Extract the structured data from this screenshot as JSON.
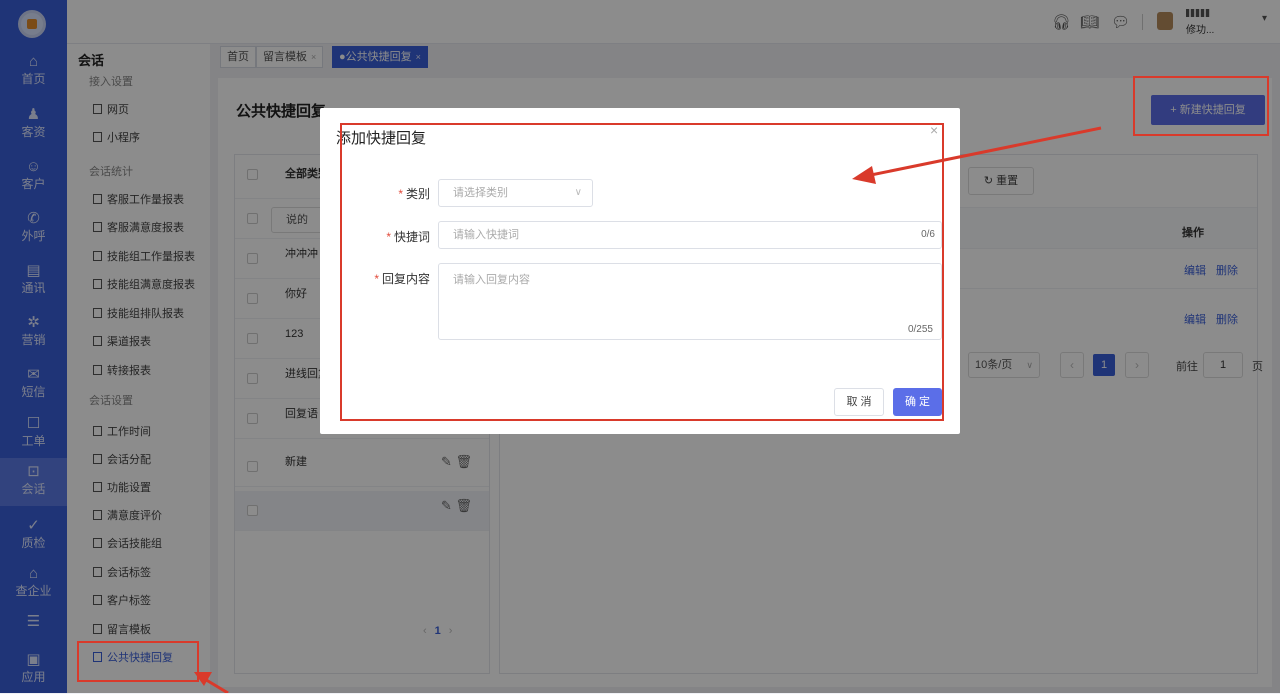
{
  "nav": {
    "items": [
      {
        "icon": "home-icon",
        "glyph": "⌂",
        "label": "首页"
      },
      {
        "icon": "visitors-icon",
        "glyph": "♟",
        "label": "客资"
      },
      {
        "icon": "customer-icon",
        "glyph": "☺",
        "label": "客户"
      },
      {
        "icon": "phone-icon",
        "glyph": "✆",
        "label": "外呼"
      },
      {
        "icon": "contacts-icon",
        "glyph": "▤",
        "label": "通讯"
      },
      {
        "icon": "marketing-icon",
        "glyph": "✲",
        "label": "营销"
      },
      {
        "icon": "sms-icon",
        "glyph": "✉",
        "label": "短信"
      },
      {
        "icon": "ticket-icon",
        "glyph": "☐",
        "label": "工单"
      },
      {
        "icon": "chat-icon",
        "glyph": "⊡",
        "label": "会话"
      },
      {
        "icon": "quality-icon",
        "glyph": "✓",
        "label": "质检"
      },
      {
        "icon": "enterprise-icon",
        "glyph": "⌂",
        "label": "查企业"
      },
      {
        "icon": "list-icon",
        "glyph": "☰",
        "label": ""
      },
      {
        "icon": "apps-icon",
        "glyph": "▣",
        "label": "应用"
      }
    ]
  },
  "topbar": {
    "icons": [
      "headset-icon",
      "book-icon",
      "message-icon"
    ],
    "user_name": "修功...",
    "colors": {
      "accent": "#3a5fd9",
      "primary_button": "#5b6ee8",
      "annotation": "#d93a2b"
    }
  },
  "subnav": {
    "title": "会话",
    "groups": [
      "接入设置",
      "会话统计",
      "会话设置"
    ],
    "items": [
      "网页",
      "小程序",
      "客服工作量报表",
      "客服满意度报表",
      "技能组工作量报表",
      "技能组满意度报表",
      "技能组排队报表",
      "渠道报表",
      "转接报表",
      "工作时间",
      "会话分配",
      "功能设置",
      "满意度评价",
      "会话技能组",
      "会话标签",
      "客户标签",
      "留言模板",
      "公共快捷回复"
    ]
  },
  "tabs": [
    {
      "label": "首页",
      "closable": false
    },
    {
      "label": "留言模板",
      "closable": true
    },
    {
      "label": "●公共快捷回复",
      "closable": true
    }
  ],
  "tab_close": "×",
  "page": {
    "title": "公共快捷回复",
    "new_button": "+ 新建快捷回复",
    "left": {
      "header": "全部类别",
      "search": "说的",
      "rows": [
        "冲冲冲",
        "你好",
        "123",
        "进线回复",
        "回复语",
        "新建",
        ""
      ],
      "pager_prev": "‹",
      "pager_current": "1",
      "pager_next": "›"
    },
    "right": {
      "reset": "↻ 重置",
      "op_header": "操作",
      "edit": "编辑",
      "delete": "删除",
      "page_size": "10条/页",
      "prev": "‹",
      "current_page": "1",
      "next": "›",
      "goto": "前往",
      "goto_value": "1",
      "page_unit": "页"
    }
  },
  "modal": {
    "title": "添加快捷回复",
    "close": "×",
    "category_label": "类别",
    "category_placeholder": "请选择类别",
    "keyword_label": "快捷词",
    "keyword_placeholder": "请输入快捷词",
    "keyword_count": "0/6",
    "content_label": "回复内容",
    "content_placeholder": "请输入回复内容",
    "content_count": "0/255",
    "cancel": "取 消",
    "confirm": "确 定",
    "required_mark": "*"
  }
}
